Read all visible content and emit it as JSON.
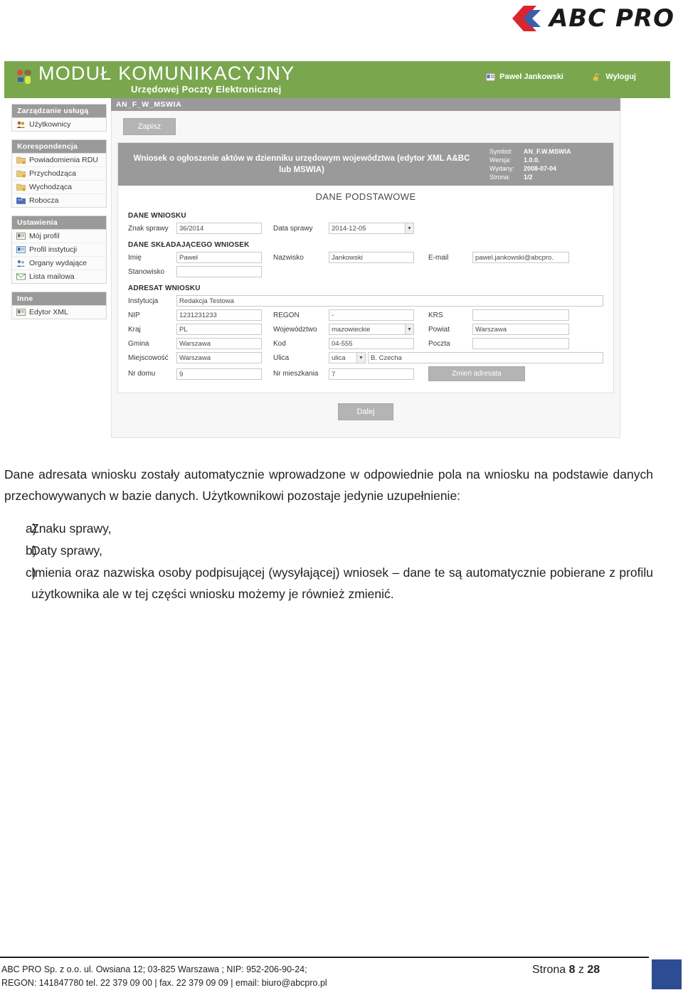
{
  "brand": {
    "name": "ABC PRO",
    "logo_red": "#d9262c",
    "logo_blue": "#3a5fab"
  },
  "screenshot": {
    "app_header": {
      "title": "MODUŁ KOMUNIKACYJNY",
      "subtitle": "Urzędowej Poczty Elektronicznej",
      "background_color": "#7aa74e",
      "user_name": "Paweł Jankowski",
      "logout_label": "Wyloguj",
      "user_icon": "id-card-icon",
      "logout_icon": "unlock-icon",
      "app_icon": "map-pins-icon"
    },
    "sidebar": {
      "groups": [
        {
          "title": "Zarządzanie usługą",
          "items": [
            {
              "label": "Użytkownicy",
              "icon": "users-icon"
            }
          ]
        },
        {
          "title": "Korespondencja",
          "items": [
            {
              "label": "Powiadomienia RDU",
              "icon": "folder-icon"
            },
            {
              "label": "Przychodząca",
              "icon": "folder-icon"
            },
            {
              "label": "Wychodząca",
              "icon": "folder-icon"
            },
            {
              "label": "Robocza",
              "icon": "folder-blue-icon"
            }
          ]
        },
        {
          "title": "Ustawienia",
          "items": [
            {
              "label": "Mój profil",
              "icon": "id-card-icon"
            },
            {
              "label": "Profil instytucji",
              "icon": "id-card-blue-icon"
            },
            {
              "label": "Organy wydające",
              "icon": "users-group-icon"
            },
            {
              "label": "Lista mailowa",
              "icon": "envelope-icon"
            }
          ]
        },
        {
          "title": "Inne",
          "items": [
            {
              "label": "Edytor XML",
              "icon": "id-card-icon"
            }
          ]
        }
      ]
    },
    "content": {
      "tab_label": "AN_F_W_MSWIA",
      "save_button": "Zapisz",
      "next_button": "Dalej",
      "form_title": "Wniosek o ogłoszenie aktów w dzienniku urzędowym województwa (edytor XML A&BC lub MSWIA)",
      "form_meta": [
        {
          "key": "Symbol:",
          "value": "AN_F.W.MSWIA"
        },
        {
          "key": "Wersja:",
          "value": "1.0.0."
        },
        {
          "key": "Wydany:",
          "value": "2008-07-04"
        },
        {
          "key": "Strona:",
          "value": "1/2"
        }
      ],
      "section_main_title": "DANE PODSTAWOWE",
      "sections": {
        "dane_wniosku": {
          "label": "DANE WNIOSKU",
          "znak_sprawy_label": "Znak sprawy",
          "znak_sprawy_value": "36/2014",
          "data_sprawy_label": "Data sprawy",
          "data_sprawy_value": "2014-12-05"
        },
        "dane_skladajacego": {
          "label": "DANE SKŁADAJĄCEGO WNIOSEK",
          "imie_label": "Imię",
          "imie_value": "Paweł",
          "nazwisko_label": "Nazwisko",
          "nazwisko_value": "Jankowski",
          "email_label": "E-mail",
          "email_value": "pawel.jankowski@abcpro.",
          "stanowisko_label": "Stanowisko",
          "stanowisko_value": ""
        },
        "adresat": {
          "label": "ADRESAT WNIOSKU",
          "instytucja_label": "Instytucja",
          "instytucja_value": "Redakcja Testowa",
          "nip_label": "NIP",
          "nip_value": "1231231233",
          "regon_label": "REGON",
          "regon_value": "-",
          "krs_label": "KRS",
          "krs_value": "",
          "kraj_label": "Kraj",
          "kraj_value": "PL",
          "wojewodztwo_label": "Województwo",
          "wojewodztwo_value": "mazowieckie",
          "powiat_label": "Powiat",
          "powiat_value": "Warszawa",
          "gmina_label": "Gmina",
          "gmina_value": "Warszawa",
          "kod_label": "Kod",
          "kod_value": "04-555",
          "poczta_label": "Poczta",
          "poczta_value": "",
          "miejscowosc_label": "Miejscowość",
          "miejscowosc_value": "Warszawa",
          "ulica_label": "Ulica",
          "ulica_type_value": "ulica",
          "ulica_value": "B. Czecha",
          "nr_domu_label": "Nr domu",
          "nr_domu_value": "9",
          "nr_mieszkania_label": "Nr mieszkania",
          "nr_mieszkania_value": "7",
          "change_button": "Zmień adresata"
        }
      }
    }
  },
  "document": {
    "paragraph": "Dane adresata wniosku zostały automatycznie wprowadzone w odpowiednie pola na wniosku na podstawie danych przechowywanych w bazie danych. Użytkownikowi pozostaje jedynie uzupełnienie:",
    "list": [
      {
        "marker": "a)",
        "text": "Znaku sprawy,"
      },
      {
        "marker": "b)",
        "text": "Daty sprawy,"
      },
      {
        "marker": "c)",
        "text": "Imienia oraz nazwiska osoby podpisującej (wysyłającej) wniosek – dane te są automatycznie pobierane z profilu użytkownika ale w tej części wniosku możemy je również zmienić."
      }
    ]
  },
  "footer": {
    "line1": "ABC PRO Sp. z o.o. ul. Owsiana 12;  03-825 Warszawa ; NIP: 952-206-90-24;",
    "line2": "REGON: 141847780 tel. 22 379 09 00 | fax. 22 379 09 09 | email: biuro@abcpro.pl",
    "page_prefix": "Strona ",
    "page_current": "8",
    "page_mid": " z ",
    "page_total": "28",
    "accent_color": "#2e4c92"
  }
}
